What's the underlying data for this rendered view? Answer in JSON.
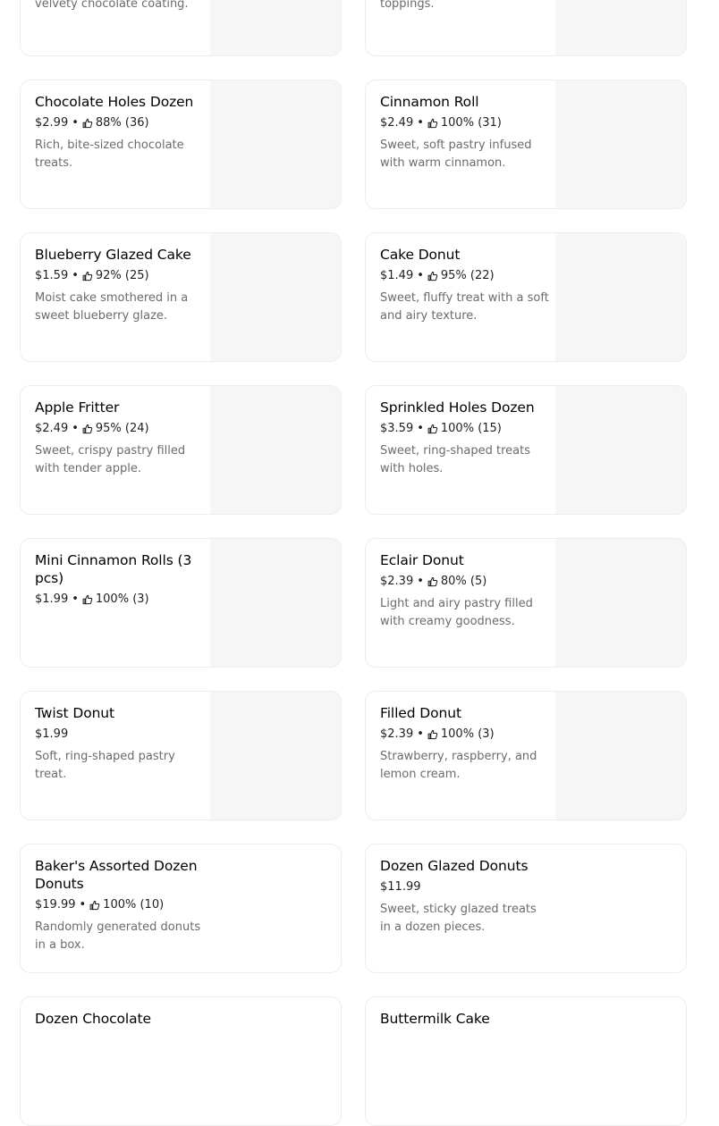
{
  "menu": {
    "items": [
      {
        "name": "",
        "price": "",
        "rating": "",
        "description": "velvety chocolate coating.",
        "image": true
      },
      {
        "name": "",
        "price": "",
        "rating": "",
        "description": "toppings.",
        "image": true
      },
      {
        "name": "Chocolate Holes Dozen",
        "price": "$2.99",
        "rating": "88% (36)",
        "description": "Rich, bite-sized chocolate treats.",
        "image": true
      },
      {
        "name": "Cinnamon Roll",
        "price": "$2.49",
        "rating": "100% (31)",
        "description": "Sweet, soft pastry infused with warm cinnamon.",
        "image": true
      },
      {
        "name": "Blueberry Glazed Cake",
        "price": "$1.59",
        "rating": "92% (25)",
        "description": "Moist cake smothered in a sweet blueberry glaze.",
        "image": true
      },
      {
        "name": "Cake Donut",
        "price": "$1.49",
        "rating": "95% (22)",
        "description": "Sweet, fluffy treat with a soft and airy texture.",
        "image": true
      },
      {
        "name": "Apple Fritter",
        "price": "$2.49",
        "rating": "95% (24)",
        "description": "Sweet, crispy pastry filled with tender apple.",
        "image": true
      },
      {
        "name": "Sprinkled Holes Dozen",
        "price": "$3.59",
        "rating": "100% (15)",
        "description": "Sweet, ring-shaped treats with holes.",
        "image": true
      },
      {
        "name": "Mini Cinnamon Rolls (3 pcs)",
        "price": "$1.99",
        "rating": "100% (3)",
        "description": "",
        "image": true
      },
      {
        "name": "Eclair Donut",
        "price": "$2.39",
        "rating": "80% (5)",
        "description": "Light and airy pastry filled with creamy goodness.",
        "image": true
      },
      {
        "name": "Twist Donut",
        "price": "$1.99",
        "rating": "",
        "description": "Soft, ring-shaped pastry treat.",
        "image": true
      },
      {
        "name": "Filled Donut",
        "price": "$2.39",
        "rating": "100% (3)",
        "description": "Strawberry, raspberry, and lemon cream.",
        "image": true
      },
      {
        "name": "Baker's Assorted Dozen Donuts",
        "price": "$19.99",
        "rating": "100% (10)",
        "description": "Randomly generated donuts in a box.",
        "image": false
      },
      {
        "name": "Dozen Glazed Donuts",
        "price": "$11.99",
        "rating": "",
        "description": "Sweet, sticky glazed treats in a dozen pieces.",
        "image": false
      },
      {
        "name": "Dozen Chocolate",
        "price": "",
        "rating": "",
        "description": "",
        "image": false
      },
      {
        "name": "Buttermilk Cake",
        "price": "",
        "rating": "",
        "description": "",
        "image": false
      }
    ]
  },
  "icons": {
    "rating": "thumbs-up-icon"
  },
  "colors": {
    "card_border": "#ededed",
    "thumb_bg": "#f6f6f6",
    "desc_text": "#6b6b6b"
  }
}
